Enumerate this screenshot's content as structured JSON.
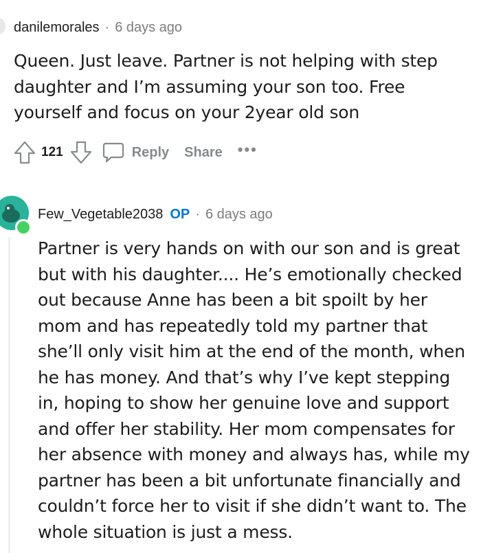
{
  "comments": [
    {
      "username": "danilemorales",
      "separator": "·",
      "time": "6 days ago",
      "body": "Queen. Just leave. Partner is not helping with step daughter and I’m assuming your son too. Free yourself and focus on your 2year old son",
      "votes": "121",
      "reply_label": "Reply",
      "share_label": "Share",
      "more_label": "•••"
    },
    {
      "username": "Few_Vegetable2038",
      "badge": "OP",
      "separator": "·",
      "time": "6 days ago",
      "body": "Partner is very hands on with our son and is great but with his daughter.... He’s emotionally checked out because Anne has been a bit spoilt by her mom and has repeatedly told my partner that she’ll only visit him at the end of the month, when he has money. And that’s why I’ve kept stepping in, hoping to show her genuine love and support and offer her stability. Her mom compensates for her absence with money and always has, while my partner has been a bit unfortunate financially and couldn’t force her to visit if she didn’t want to. The whole situation is just a mess."
    }
  ],
  "icons": {
    "upvote": "upvote-arrow-icon",
    "downvote": "downvote-arrow-icon",
    "reply": "speech-bubble-icon",
    "more": "more-dots-icon"
  },
  "colors": {
    "op_badge": "#0079d3",
    "meta_text": "#7c7c7c",
    "avatar_bg": "#28b39a",
    "online_dot": "#46d160"
  }
}
